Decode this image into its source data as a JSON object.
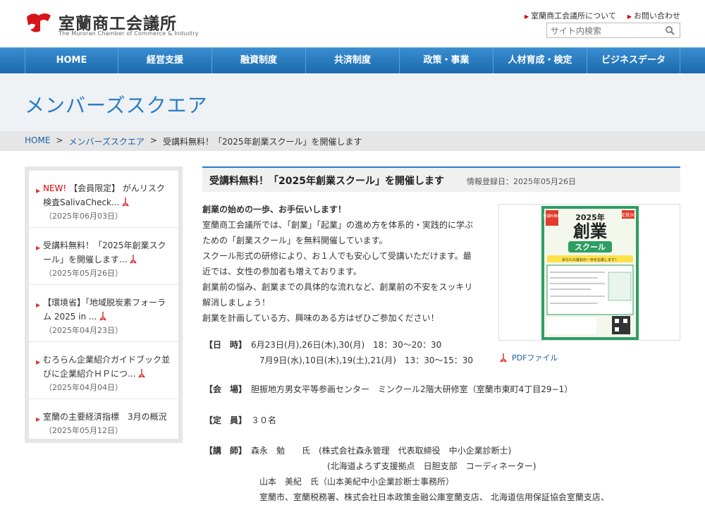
{
  "header": {
    "logo_jp": "室蘭商工会議所",
    "logo_en": "The Muroran Chamber of Commerce & Industry",
    "links": [
      "室蘭商工会議所について",
      "お問い合わせ"
    ],
    "search_placeholder": "サイト内検索",
    "brand_color": "#d7141a"
  },
  "nav": [
    "HOME",
    "経営支援",
    "融資制度",
    "共済制度",
    "政策・事業",
    "人材育成・検定",
    "ビジネスデータ"
  ],
  "page_title": "メンバーズスクエア",
  "breadcrumb": [
    "HOME",
    "メンバーズスクエア",
    "受講料無料！「2025年創業スクール」を開催します"
  ],
  "sidebar": [
    {
      "new": "NEW!",
      "title": "【会員限定】 がんリスク検査SalivaCheck...",
      "date": "（2025年06月03日）"
    },
    {
      "new": "",
      "title": "受講料無料！「2025年創業スクール」を開催します...",
      "date": "（2025年05月26日）"
    },
    {
      "new": "",
      "title": "【環境省】「地域脱炭素フォーラム 2025 in ...",
      "date": "（2025年04月23日）"
    },
    {
      "new": "",
      "title": "むろらん企業紹介ガイドブック並びに企業紹介ＨＰにつ...",
      "date": "（2025年04月04日）"
    },
    {
      "new": "",
      "title": "室蘭の主要経済指標　3月の概況",
      "date": "（2025年05月12日）"
    }
  ],
  "article": {
    "title": "受講料無料！「2025年創業スクール」を開催します",
    "date": "情報登録日：2025年05月26日",
    "lead": "創業の始めの一歩、お手伝いします！",
    "body": [
      "室蘭商工会議所では、「創業」「起業」の進め方を体系的・実践的に学ぶ",
      "ための「創業スクール」を無料開催しています。",
      "スクール形式の研修により、お１人でも安心して受講いただけます。最",
      "近では、女性の参加者も増えております。",
      "創業前の悩み、創業までの具体的な流れなど、創業前の不安をスッキリ",
      "解消しましょう！",
      "創業を計画している方、興味のある方はぜひご参加ください！"
    ],
    "pdf_label": "PDFファイル",
    "flyer": {
      "badge_left": "受講料無料",
      "year": "2025年",
      "badge_right": "定員30",
      "title": "創業",
      "subtitle": "スクール",
      "tagline": "あなたの最初の一歩を応援します！"
    }
  },
  "info": {
    "date_label": "【日　時】",
    "date_lines": [
      "6月23日(月),26日(木),30(月)　18：30～20：30",
      "　7月9日(水),10日(木),19(土),21(月)　13：30～15：30"
    ],
    "venue_label": "【会　場】",
    "venue": "胆振地方男女平等参画センター　ミンクール2階大研修室（室蘭市東町4丁目29−1）",
    "capacity_label": "【定　員】",
    "capacity": "３０名",
    "lecturer_label": "【講　師】",
    "lecturer_lines": [
      "森永　勉　　氏　(株式会社森永管理　代表取締役　中小企業診断士)",
      "　　　　　　　　　(北海道よろず支援拠点　日胆支部　コーディネーター)",
      "　山本　美紀　氏（山本美紀中小企業診断士事務所）",
      "　室蘭市、室蘭税務署、株式会社日本政策金融公庫室蘭支店、 北海道信用保証協会室蘭支店、"
    ]
  }
}
